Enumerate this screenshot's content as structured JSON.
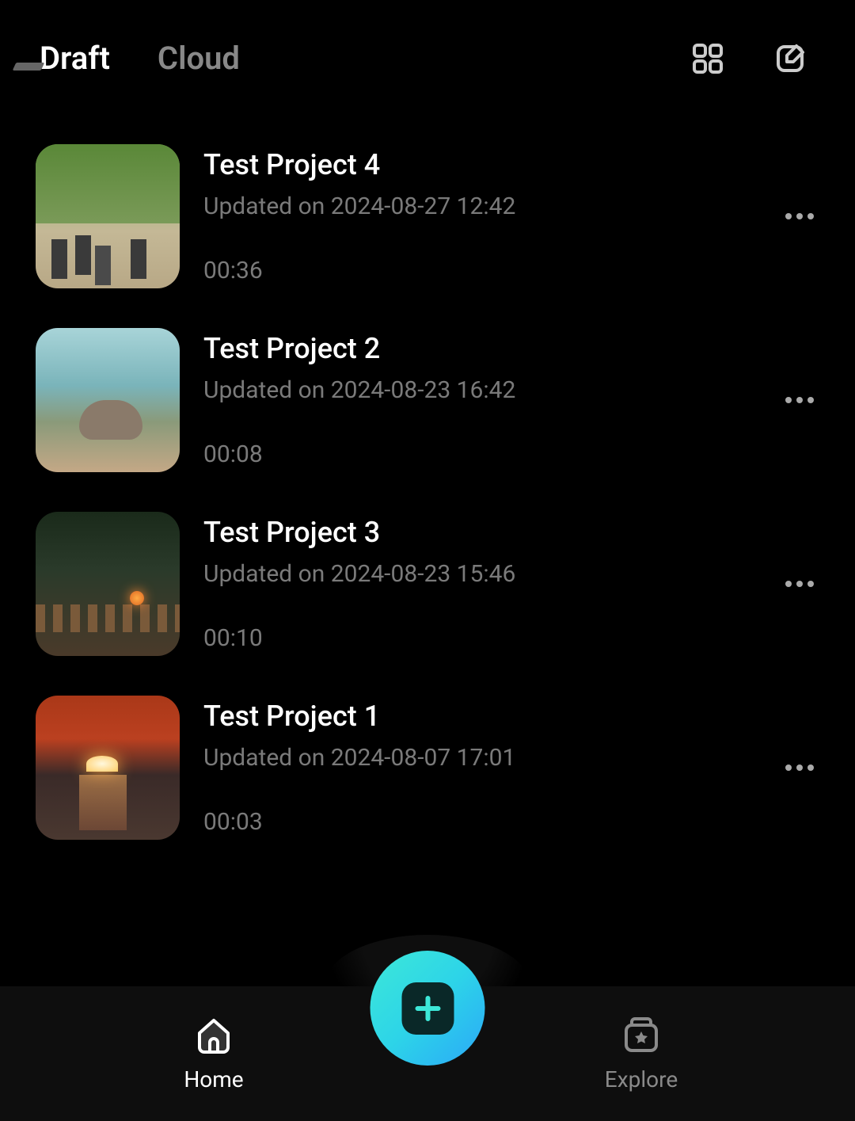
{
  "header": {
    "tabs": [
      {
        "label": "Draft",
        "active": true
      },
      {
        "label": "Cloud",
        "active": false
      }
    ]
  },
  "projects": [
    {
      "title": "Test Project 4",
      "updated": "Updated on 2024-08-27 12:42",
      "duration": "00:36"
    },
    {
      "title": "Test Project 2",
      "updated": "Updated on 2024-08-23 16:42",
      "duration": "00:08"
    },
    {
      "title": "Test Project 3",
      "updated": "Updated on 2024-08-23 15:46",
      "duration": "00:10"
    },
    {
      "title": "Test Project 1",
      "updated": "Updated on 2024-08-07 17:01",
      "duration": "00:03"
    }
  ],
  "nav": {
    "home": "Home",
    "explore": "Explore"
  }
}
